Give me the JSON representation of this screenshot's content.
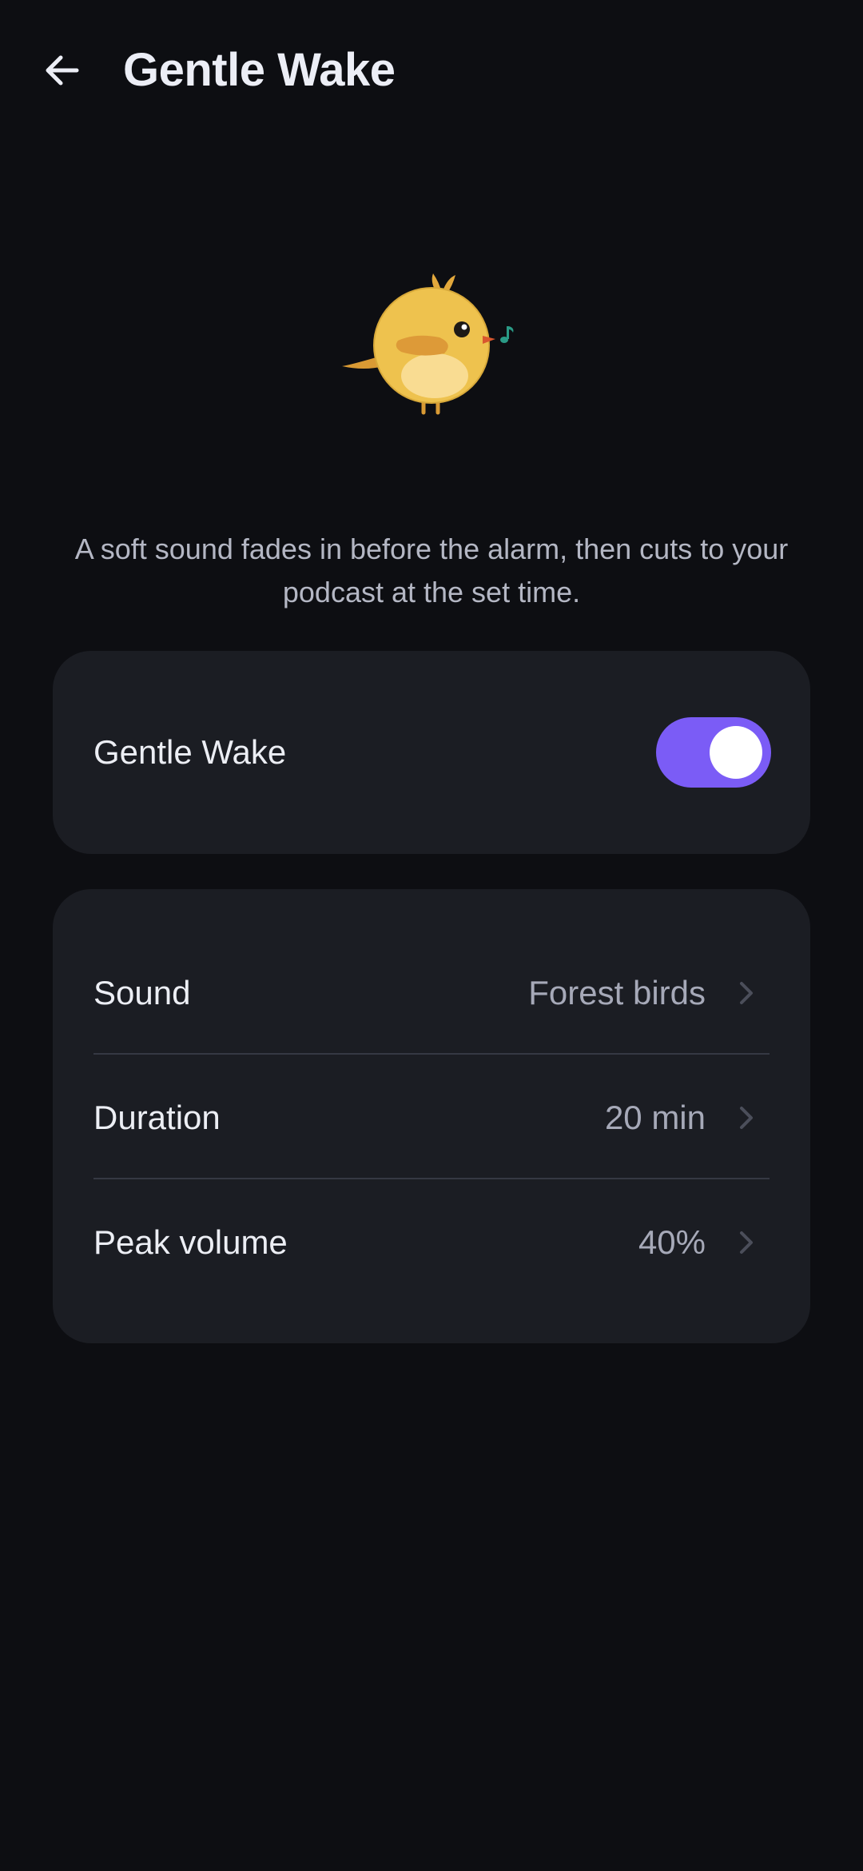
{
  "header": {
    "title": "Gentle Wake",
    "back_icon": "arrow-left-icon"
  },
  "hero": {
    "illustration": "bird-singing-icon"
  },
  "description": "A soft sound fades in before the alarm, then cuts to your podcast at the set time.",
  "toggle_card": {
    "label": "Gentle Wake",
    "enabled": true,
    "accent_color": "#7b5cf6"
  },
  "settings": {
    "rows": [
      {
        "label": "Sound",
        "value": "Forest birds",
        "icon": "chevron-right-icon"
      },
      {
        "label": "Duration",
        "value": "20 min",
        "icon": "chevron-right-icon"
      },
      {
        "label": "Peak volume",
        "value": "40%",
        "icon": "chevron-right-icon"
      }
    ]
  },
  "colors": {
    "background": "#0d0e12",
    "card": "#1b1d23",
    "accent": "#7b5cf6",
    "bird_body": "#eec24e"
  }
}
